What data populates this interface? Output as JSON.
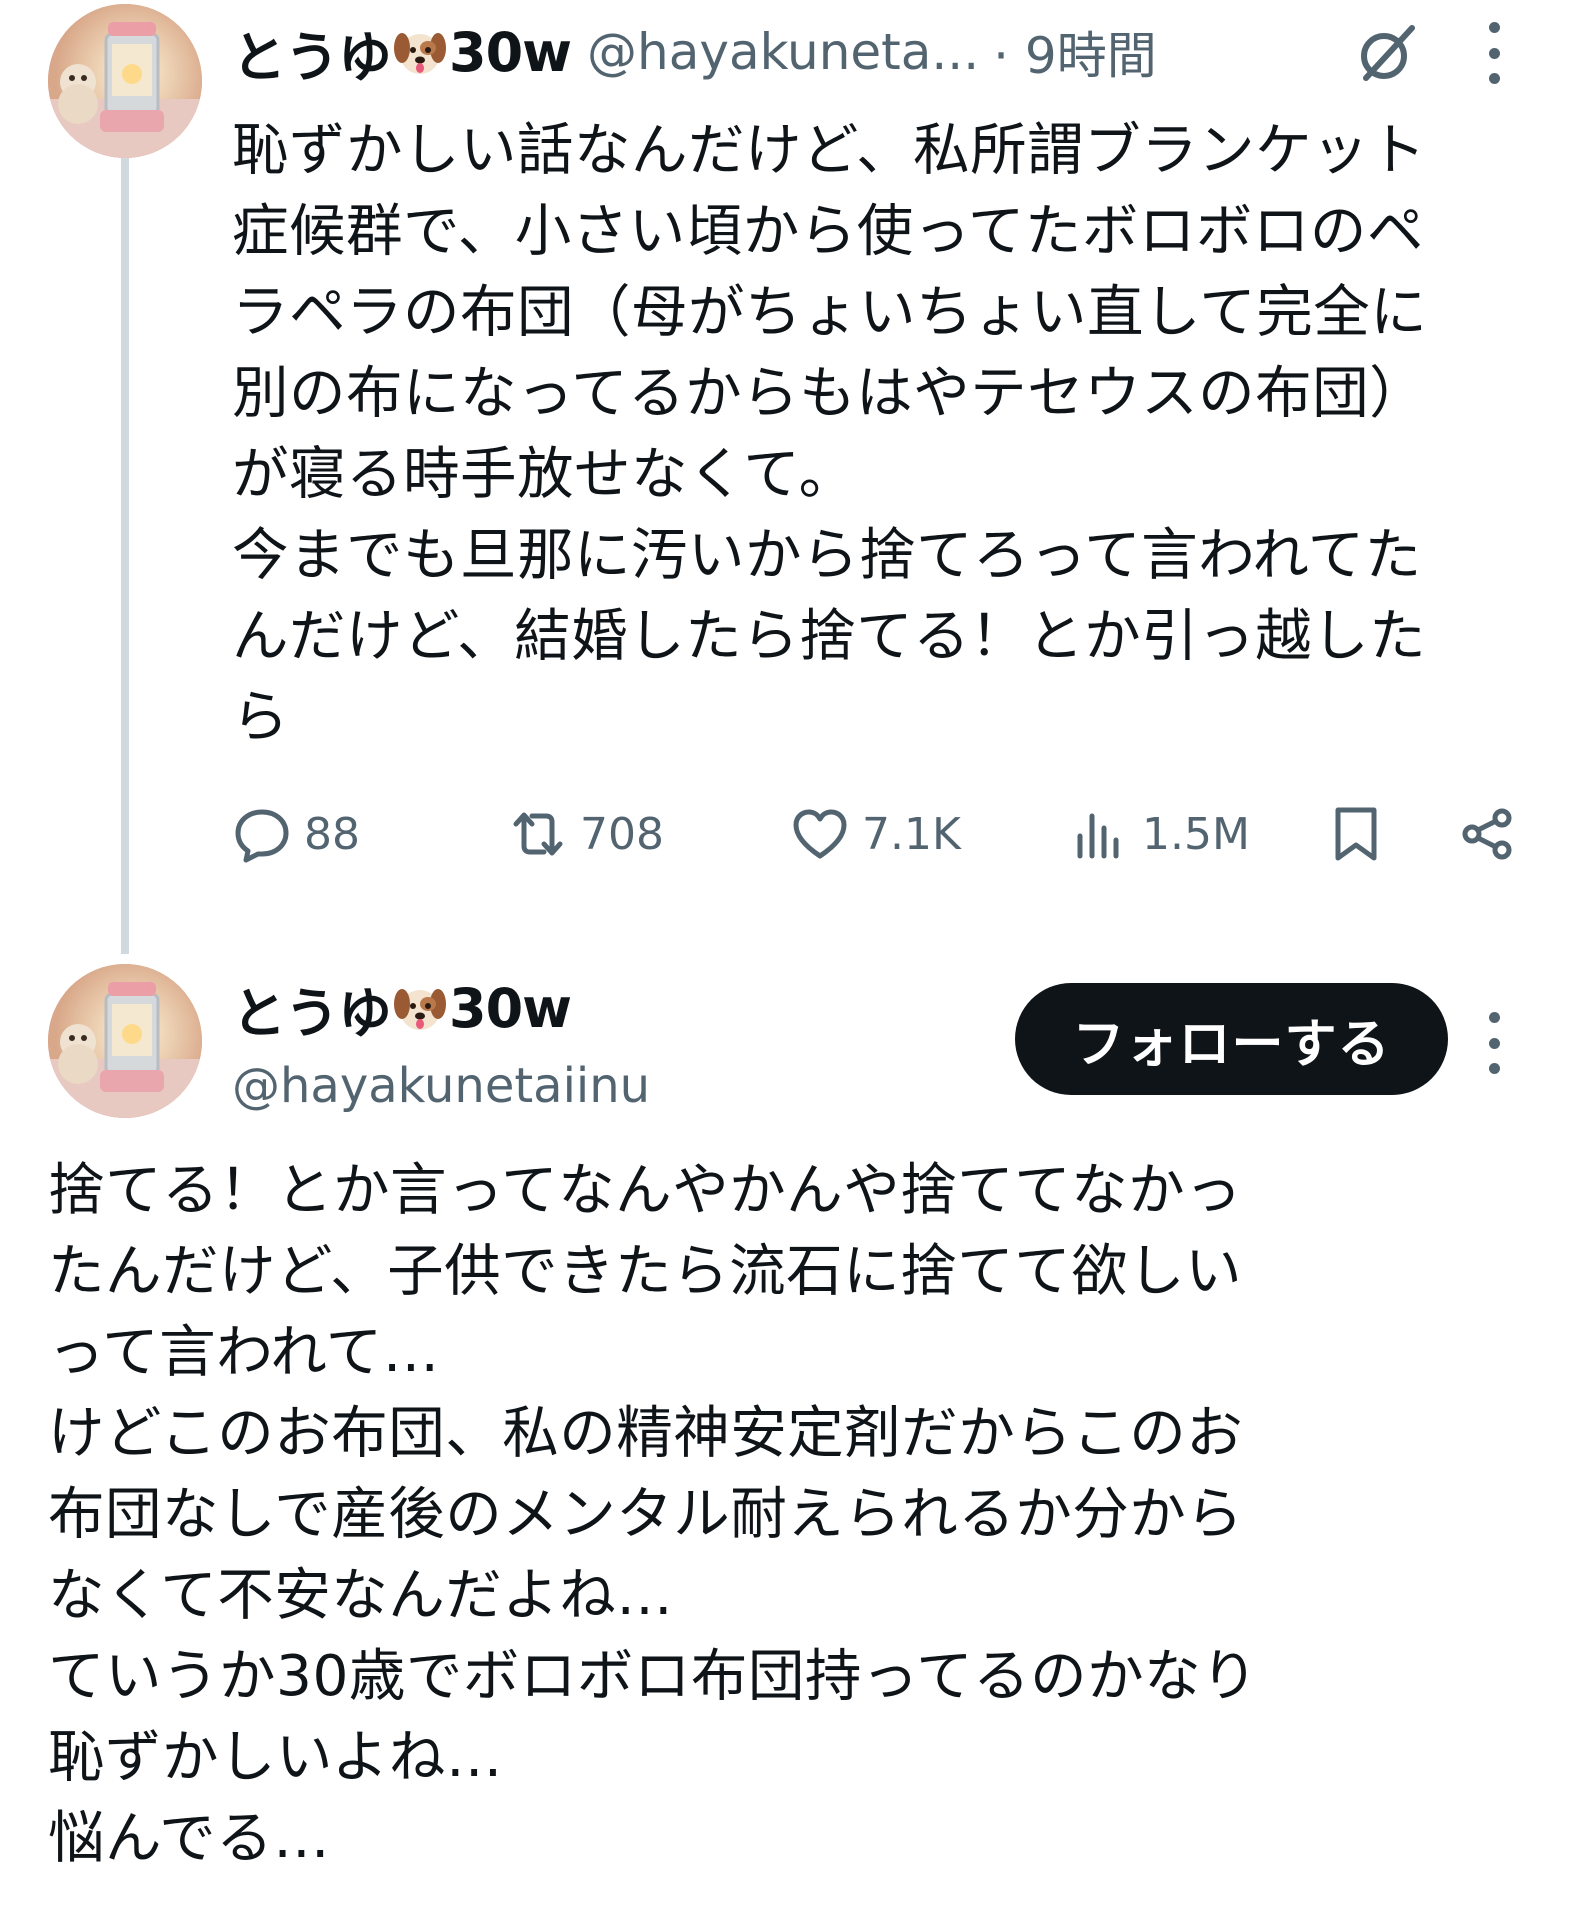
{
  "tweet": {
    "author_name": "とうゆ",
    "author_suffix": "30w",
    "handle": "@hayakuneta...",
    "time": "· 9時間",
    "text": "恥ずかしい話なんだけど、私所謂ブランケット\n症候群で、小さい頃から使ってたボロボロのペ\nラペラの布団（母がちょいちょい直して完全に\n別の布になってるからもはやテセウスの布団）\nが寝る時手放せなくて。\n今までも旦那に汚いから捨てろって言われてた\nんだけど、結婚したら捨てる！とか引っ越した\nら",
    "replies": "88",
    "reposts": "708",
    "likes": "7.1K",
    "views": "1.5M"
  },
  "reply_post": {
    "author_name": "とうゆ",
    "author_suffix": "30w",
    "handle": "@hayakunetaiinu",
    "follow_label": "フォローする",
    "text": "捨てる！とか言ってなんやかんや捨ててなかっ\nたんだけど、子供できたら流石に捨てて欲しい\nって言われて…\nけどこのお布団、私の精神安定剤だからこのお\n布団なしで産後のメンタル耐えられるか分から\nなくて不安なんだよね…\nていうか30歳でボロボロ布団持ってるのかなり\n恥ずかしいよね…\n悩んでる…"
  },
  "icons": {
    "emoji": "dog-face-emoji",
    "grok": "grok-icon",
    "more": "more-options-icon",
    "reply": "reply-icon",
    "repost": "repost-icon",
    "like": "heart-icon",
    "views": "views-icon",
    "bookmark": "bookmark-icon",
    "share": "share-icon"
  },
  "colors": {
    "text": "#0f1419",
    "secondary": "#536471",
    "thread_line": "#cfd9de",
    "button_bg": "#0f1419",
    "button_text": "#ffffff"
  }
}
